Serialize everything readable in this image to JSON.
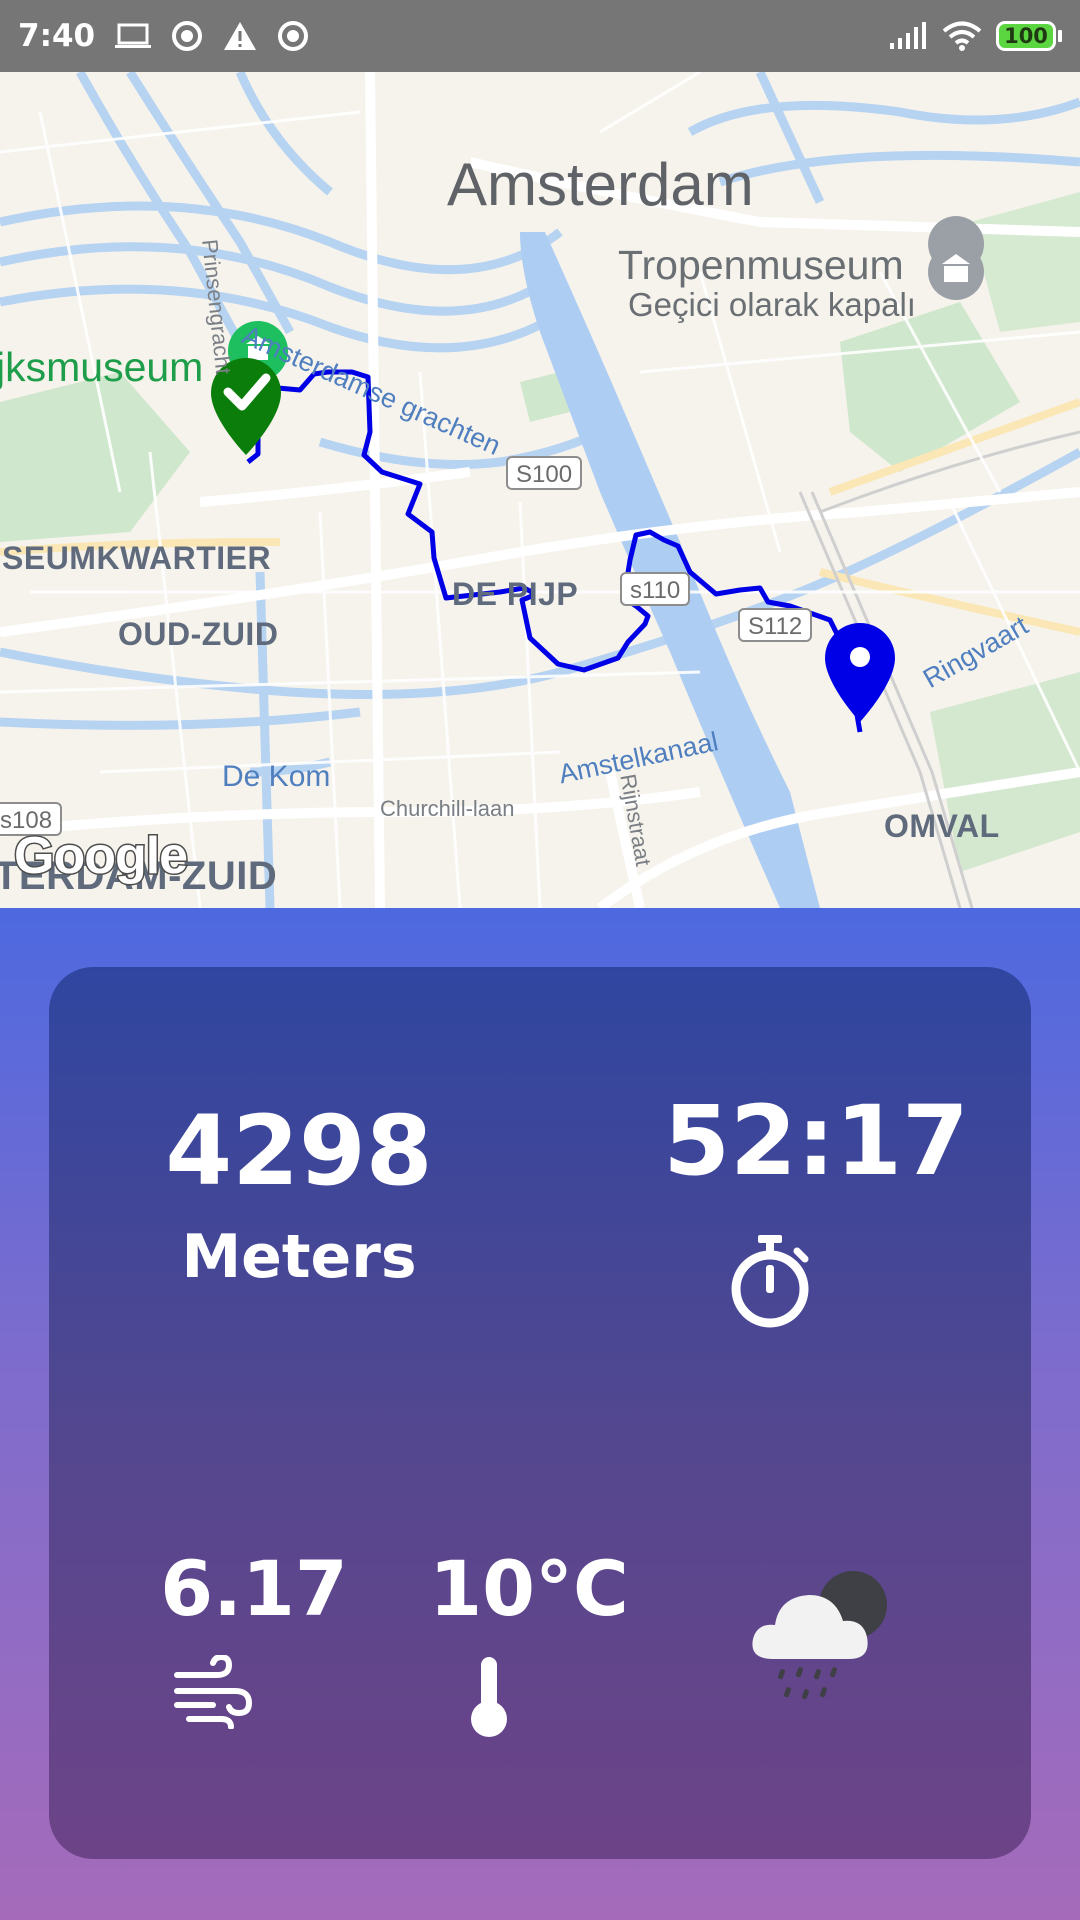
{
  "status_bar": {
    "time": "7:40",
    "left_icons": [
      "laptop-icon",
      "record-icon",
      "warning-icon",
      "record-icon"
    ],
    "right_icons": [
      "signal-icon",
      "wifi-icon",
      "battery-icon"
    ],
    "battery_level": "100"
  },
  "map": {
    "city_label": "Amsterdam",
    "poi_name": "Tropenmuseum",
    "poi_status": "Geçici olarak kapalı",
    "museum_label": "jksmuseum",
    "district_labels": [
      "SEUMKWARTIER",
      "OUD-ZUID",
      "DE PIJP",
      "OMVAL",
      "TERDAM-ZUID"
    ],
    "water_labels": [
      "Amsterdamse grachten",
      "Amstelkanaal",
      "Ringvaart",
      "De Kom"
    ],
    "street_labels": [
      "Prinsengracht",
      "Churchill-laan",
      "Rijnstraat"
    ],
    "road_shields": [
      "S100",
      "s110",
      "S112",
      "s108"
    ],
    "attribution": "Google",
    "route_color": "#0000e6",
    "start_marker_color": "#0a7d0a",
    "end_marker_color": "#0000e6"
  },
  "stats": {
    "distance_value": "4298",
    "distance_unit": "Meters",
    "duration": "52:17",
    "wind_speed": "6.17",
    "temperature": "10°C",
    "weather_icon": "night-rain-cloud-icon"
  },
  "colors": {
    "status_bar": "#767676",
    "card_top": "#2f46a0",
    "card_bottom": "#6d4387",
    "background_top": "#4d69df",
    "background_bottom": "#a56bba"
  }
}
